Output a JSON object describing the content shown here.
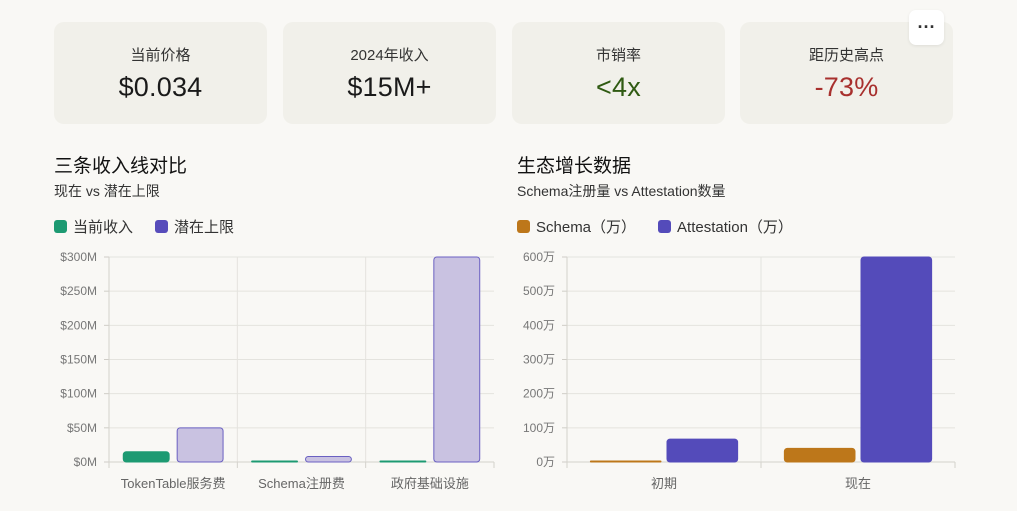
{
  "cards": [
    {
      "label": "当前价格",
      "value": "$0.034",
      "color": "#1a1a1a"
    },
    {
      "label": "2024年收入",
      "value": "$15M+",
      "color": "#1a1a1a"
    },
    {
      "label": "市销率",
      "value": "<4x",
      "color": "#2f5a12"
    },
    {
      "label": "距历史高点",
      "value": "-73%",
      "color": "#a8302e"
    }
  ],
  "more_button": {
    "label": "···"
  },
  "left": {
    "title": "三条收入线对比",
    "subtitle": "现在 vs 潜在上限",
    "legend": [
      {
        "label": "当前收入",
        "color": "#1d9a72"
      },
      {
        "label": "潜在上限",
        "color": "#574cbb"
      }
    ]
  },
  "right": {
    "title": "生态增长数据",
    "subtitle": "Schema注册量 vs Attestation数量",
    "legend": [
      {
        "label": "Schema（万）",
        "color": "#bd771a"
      },
      {
        "label": "Attestation（万）",
        "color": "#544bba"
      }
    ]
  },
  "chart_data": [
    {
      "type": "bar",
      "categories": [
        "TokenTable服务费",
        "Schema注册费",
        "政府基础设施"
      ],
      "series": [
        {
          "name": "当前收入",
          "values": [
            15,
            0.5,
            1
          ],
          "fill": "#1d9a72",
          "stroke": "#1d9a72"
        },
        {
          "name": "潜在上限",
          "values": [
            50,
            8,
            300
          ],
          "fill": "#c9c2e1",
          "stroke": "#6a60c2"
        }
      ],
      "ylim": [
        0,
        300
      ],
      "yticks": [
        0,
        50,
        100,
        150,
        200,
        250,
        300
      ],
      "ytick_labels": [
        "$0M",
        "$50M",
        "$100M",
        "$150M",
        "$200M",
        "$250M",
        "$300M"
      ],
      "grid": true
    },
    {
      "type": "bar",
      "categories": [
        "初期",
        "现在"
      ],
      "series": [
        {
          "name": "Schema（万）",
          "values": [
            0.5,
            40
          ],
          "fill": "#bd771a",
          "stroke": "#bd771a"
        },
        {
          "name": "Attestation（万）",
          "values": [
            67,
            600
          ],
          "fill": "#544bba",
          "stroke": "#544bba"
        }
      ],
      "ylim": [
        0,
        600
      ],
      "yticks": [
        0,
        100,
        200,
        300,
        400,
        500,
        600
      ],
      "ytick_labels": [
        "0万",
        "100万",
        "200万",
        "300万",
        "400万",
        "500万",
        "600万"
      ],
      "grid": true
    }
  ]
}
